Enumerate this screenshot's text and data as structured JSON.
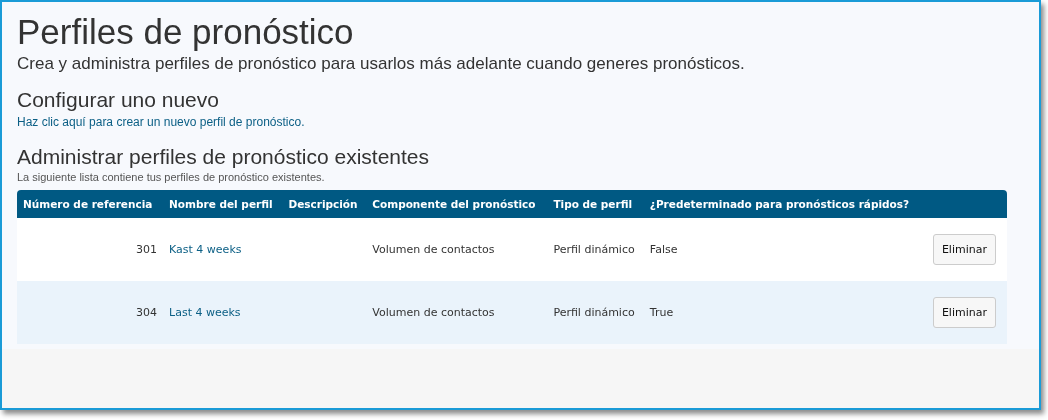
{
  "page": {
    "title": "Perfiles de pronóstico",
    "subtitle": "Crea y administra perfiles de pronóstico para usarlos más adelante cuando generes pronósticos."
  },
  "new_section": {
    "heading": "Configurar uno nuevo",
    "link": "Haz clic aquí para crear un nuevo perfil de pronóstico."
  },
  "manage_section": {
    "heading": "Administrar perfiles de pronóstico existentes",
    "description": "La siguiente lista contiene tus perfiles de pronóstico existentes."
  },
  "table": {
    "columns": [
      "Número de referencia",
      "Nombre del perfil",
      "Descripción",
      "Componente del pronóstico",
      "Tipo de perfil",
      "¿Predeterminado para pronósticos rápidos?"
    ],
    "rows": [
      {
        "reference": "301",
        "name": "Kast 4 weeks",
        "component": "Volumen de contactos",
        "type": "Perfil dinámico",
        "default": "False",
        "action": "Eliminar"
      },
      {
        "reference": "304",
        "name": "Last 4 weeks",
        "component": "Volumen de contactos",
        "type": "Perfil dinámico",
        "default": "True",
        "action": "Eliminar"
      }
    ]
  }
}
